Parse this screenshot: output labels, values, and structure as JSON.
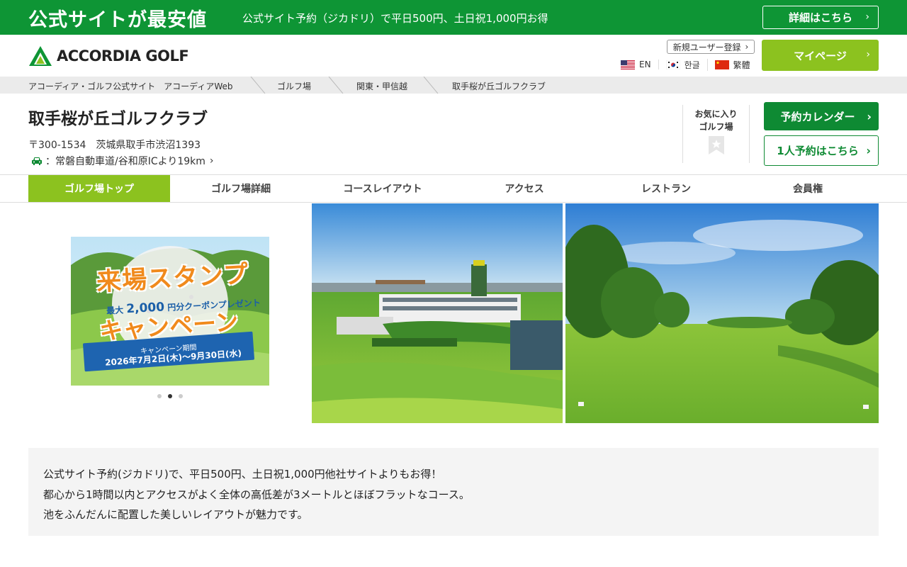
{
  "promo": {
    "title": "公式サイトが最安値",
    "text": "公式サイト予約（ジカドリ）で平日500円、土日祝1,000円お得",
    "button": "詳細はこちら"
  },
  "header": {
    "logo_text": "ACCORDIA GOLF",
    "register": "新規ユーザー登録",
    "languages": [
      {
        "label": "EN",
        "icon": "us-flag-icon"
      },
      {
        "label": "한글",
        "icon": "kr-flag-icon"
      },
      {
        "label": "繁體",
        "icon": "tw-flag-icon"
      }
    ],
    "mypage": "マイページ"
  },
  "breadcrumb": [
    "アコーディア・ゴルフ公式サイト　アコーディアWeb",
    "ゴルフ場",
    "関東・甲信越",
    "取手桜が丘ゴルフクラブ"
  ],
  "course": {
    "name": "取手桜が丘ゴルフクラブ",
    "address": "〒300-1534　茨城県取手市渋沼1393",
    "access_prefix": "：",
    "access": "常磐自動車道/谷和原ICより19km",
    "favorite_line1": "お気に入り",
    "favorite_line2": "ゴルフ場",
    "calendar_button": "予約カレンダー",
    "solo_button": "1人予約はこちら"
  },
  "tabs": [
    "ゴルフ場トップ",
    "ゴルフ場詳細",
    "コースレイアウト",
    "アクセス",
    "レストラン",
    "会員権"
  ],
  "active_tab": 0,
  "banner": {
    "title1": "来場スタンプ",
    "coupon_prefix": "最大",
    "coupon_amount": "2,000",
    "coupon_suffix": "円分クーポンプレゼント",
    "title2": "キャンペーン",
    "period_label": "キャンペーン期間",
    "period": "2026年7月2日(木)～9月30日(水)"
  },
  "carousel": {
    "count": 3,
    "active": 1
  },
  "description": [
    "公式サイト予約(ジカドリ)で、平日500円、土日祝1,000円他社サイトよりもお得！",
    "都心から1時間以内とアクセスがよく全体の高低差が3メートルとほぼフラットなコース。",
    "池をふんだんに配置した美しいレイアウトが魅力です。"
  ],
  "colors": {
    "brand_green": "#0e9535",
    "accent_lime": "#8cc21f",
    "button_green": "#0e8a33"
  }
}
